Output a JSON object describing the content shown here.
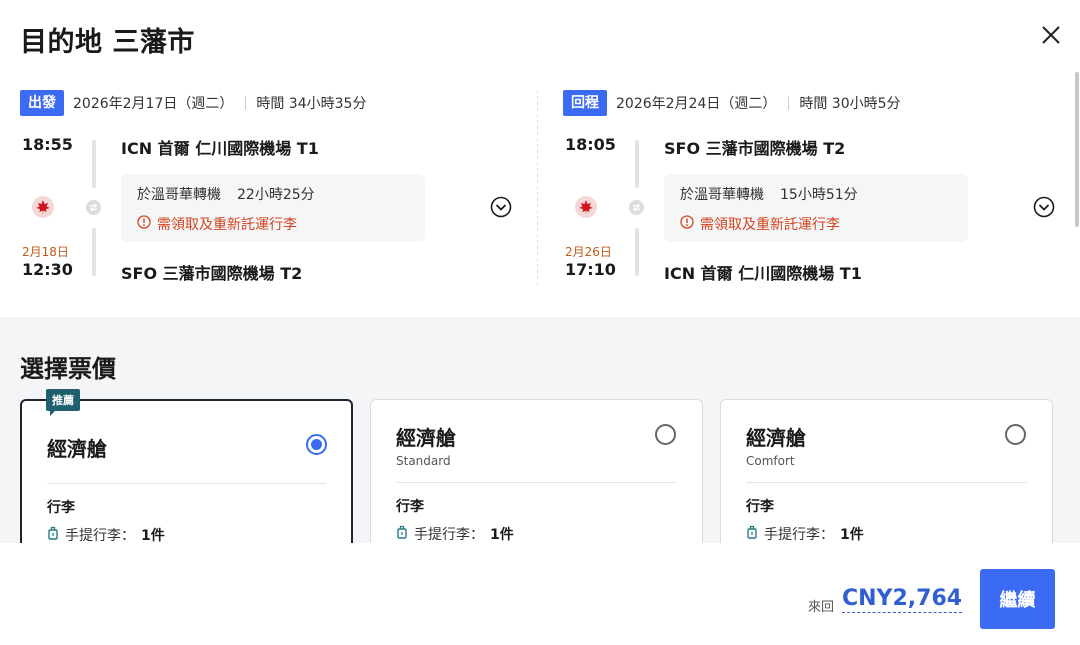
{
  "header": {
    "title": "目的地 三藩市"
  },
  "outbound": {
    "tag": "出發",
    "date": "2026年2月17日（週二）",
    "duration": "時間 34小時35分",
    "depart_time": "18:55",
    "depart_airport": "ICN 首爾 仁川國際機場 T1",
    "layover_city": "於溫哥華轉機",
    "layover_duration": "22小時25分",
    "baggage_warning": "需領取及重新託運行李",
    "arrive_date": "2月18日",
    "arrive_time": "12:30",
    "arrive_airport": "SFO 三藩市國際機場 T2"
  },
  "return": {
    "tag": "回程",
    "date": "2026年2月24日（週二）",
    "duration": "時間 30小時5分",
    "depart_time": "18:05",
    "depart_airport": "SFO 三藩市國際機場 T2",
    "layover_city": "於溫哥華轉機",
    "layover_duration": "15小時51分",
    "baggage_warning": "需領取及重新託運行李",
    "arrive_date": "2月26日",
    "arrive_time": "17:10",
    "arrive_airport": "ICN 首爾 仁川國際機場 T1"
  },
  "fares": {
    "title": "選擇票價",
    "cards": [
      {
        "badge": "推薦",
        "name": "經濟艙",
        "sub": "",
        "baggage_title": "行李",
        "carry_on_label": "手提行李：",
        "carry_on_value": "1件",
        "selected": true
      },
      {
        "badge": "",
        "name": "經濟艙",
        "sub": "Standard",
        "baggage_title": "行李",
        "carry_on_label": "手提行李：",
        "carry_on_value": "1件",
        "selected": false
      },
      {
        "badge": "",
        "name": "經濟艙",
        "sub": "Comfort",
        "baggage_title": "行李",
        "carry_on_label": "手提行李：",
        "carry_on_value": "1件",
        "selected": false
      }
    ]
  },
  "footer": {
    "price_label": "來回",
    "price": "CNY2,764",
    "continue_label": "繼續"
  },
  "colors": {
    "accent": "#3b6bf2",
    "warning": "#d2451e",
    "badge": "#1f5f6e",
    "date_highlight": "#c05a18"
  }
}
